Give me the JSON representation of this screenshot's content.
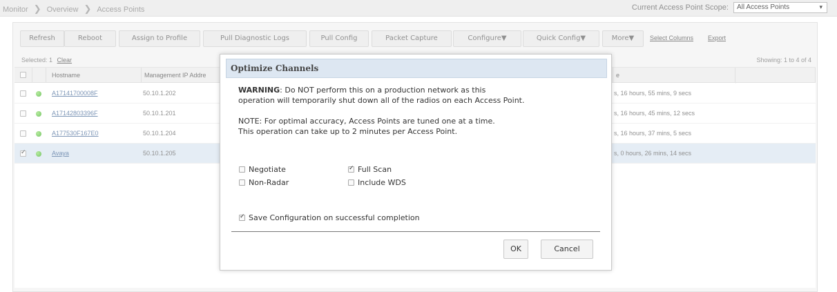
{
  "breadcrumb": {
    "items": [
      "Monitor",
      "Overview",
      "Access Points"
    ]
  },
  "scope": {
    "label": "Current Access Point Scope:",
    "value": "All Access Points"
  },
  "toolbar": {
    "buttons": [
      "Refresh",
      "Reboot",
      "Assign to Profile",
      "Pull Diagnostic Logs",
      "Pull Config",
      "Packet Capture",
      "Configure▼",
      "Quick Config▼",
      "More▼"
    ],
    "select_columns": "Select Columns",
    "export": "Export"
  },
  "selection": {
    "label": "Selected: 1",
    "clear": "Clear",
    "showing": "Showing: 1 to 4 of 4"
  },
  "table": {
    "columns": [
      "Hostname",
      "Management IP Addre",
      "e"
    ],
    "rows": [
      {
        "hostname": "A17141700008F",
        "ip": "50.10.1.202",
        "uptime": "s, 16 hours, 55 mins, 9 secs",
        "checked": false
      },
      {
        "hostname": "A17142803396F",
        "ip": "50.10.1.201",
        "uptime": "s, 16 hours, 45 mins, 12 secs",
        "checked": false
      },
      {
        "hostname": "A177530F167E0",
        "ip": "50.10.1.204",
        "uptime": "s, 16 hours, 37 mins, 5 secs",
        "checked": false
      },
      {
        "hostname": "Avaya",
        "ip": "50.10.1.205",
        "uptime": "s, 0 hours, 26 mins, 14 secs",
        "checked": true
      }
    ]
  },
  "modal": {
    "title": "Optimize Channels",
    "warning_label": "WARNING",
    "warning_line1": ": Do NOT perform this on a production network as this",
    "warning_line2": "operation will temporarily shut down all of the radios on each Access Point.",
    "note_line1": "NOTE: For optimal accuracy, Access Points are tuned one at a time.",
    "note_line2": "This operation can take up to 2 minutes per Access Point.",
    "options": {
      "negotiate": {
        "label": "Negotiate",
        "checked": false
      },
      "full_scan": {
        "label": "Full Scan",
        "checked": true
      },
      "non_radar": {
        "label": "Non-Radar",
        "checked": false
      },
      "include_wds": {
        "label": "Include WDS",
        "checked": false
      }
    },
    "save_config": {
      "label": "Save Configuration on successful completion",
      "checked": true
    },
    "ok": "OK",
    "cancel": "Cancel"
  },
  "colors": {
    "header_bg": "#dde7f2",
    "selected_row_bg": "#dbe6f1",
    "status_online": "#3fae2a",
    "link": "#4a6d9a"
  }
}
